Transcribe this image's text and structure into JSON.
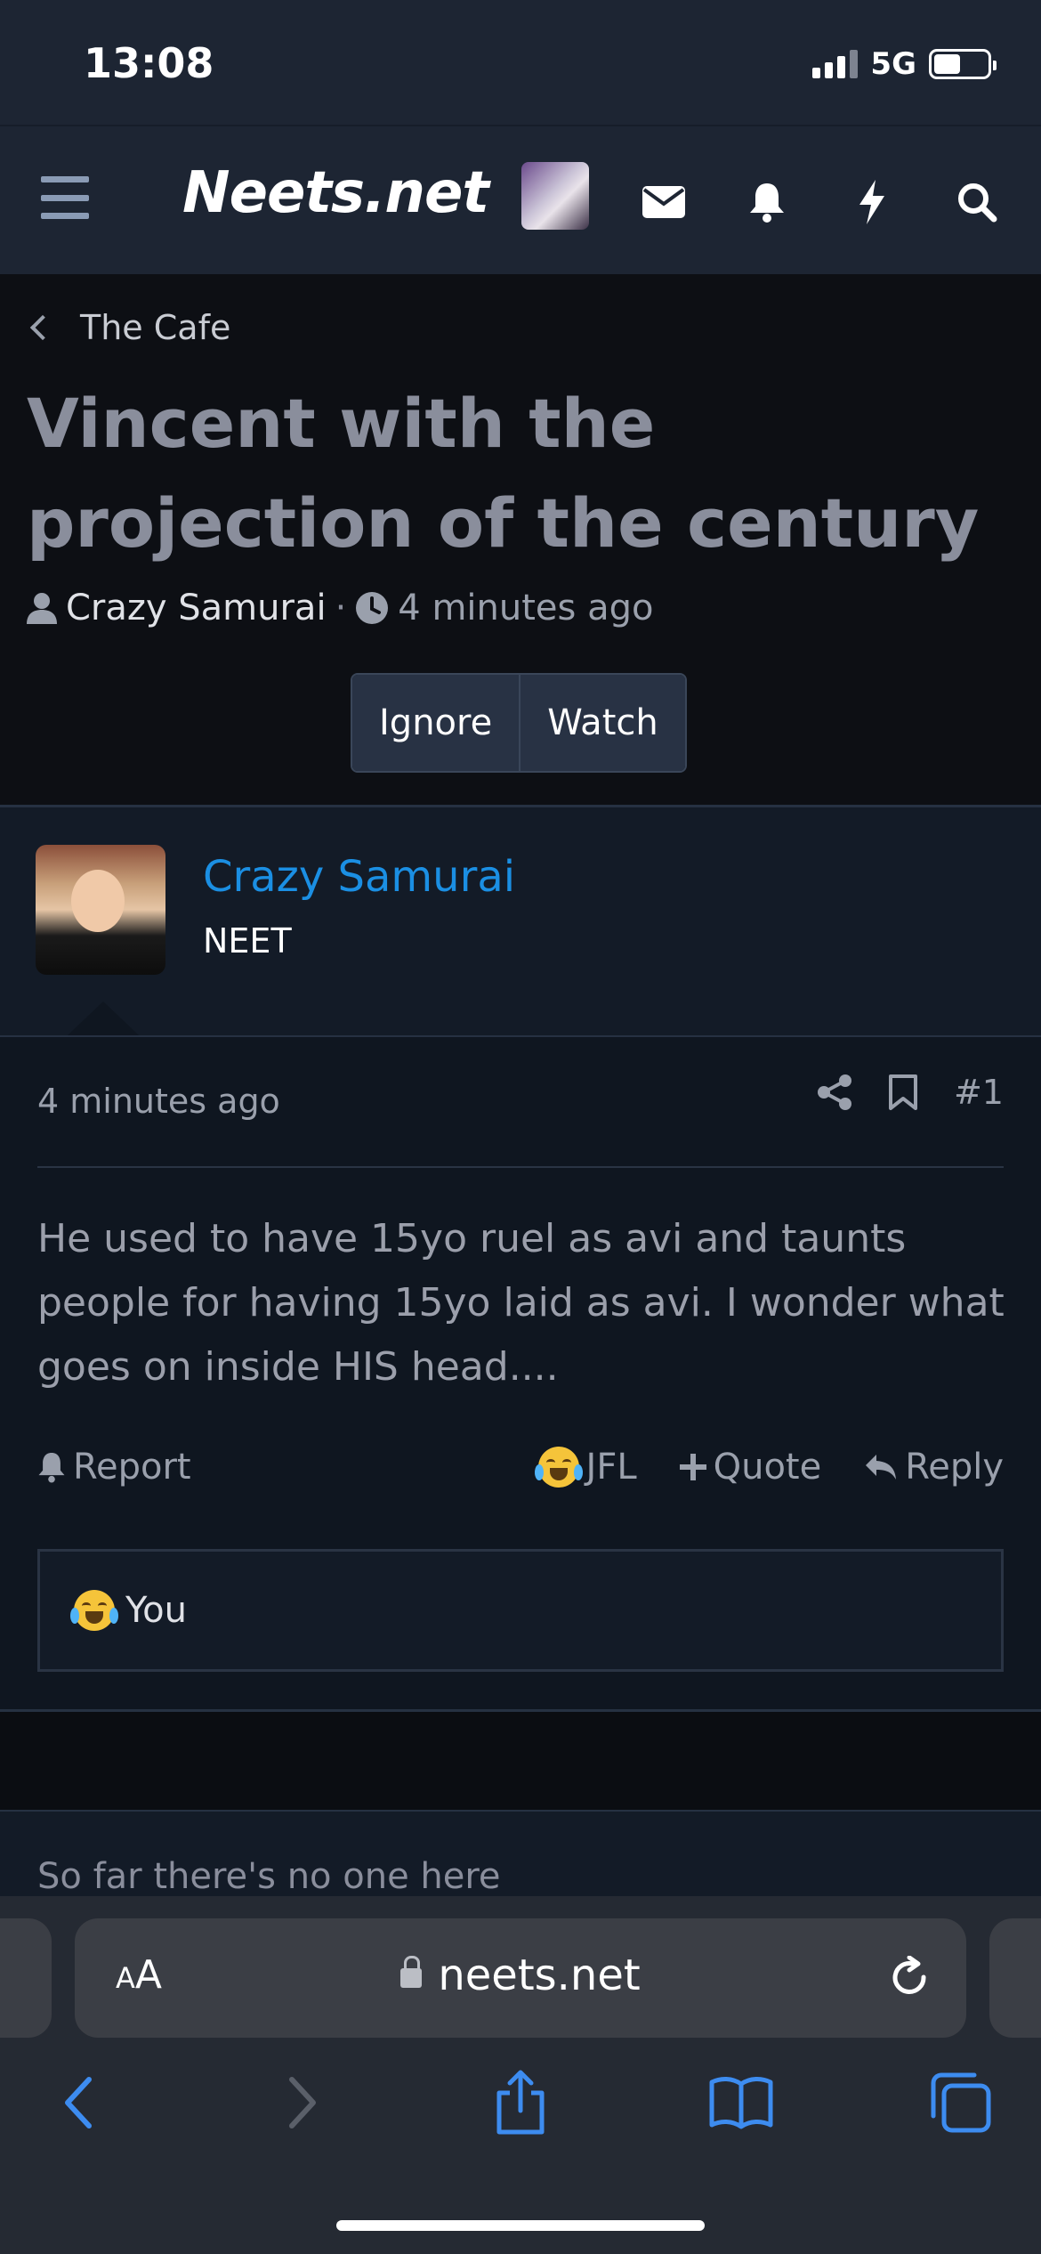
{
  "status": {
    "time": "13:08",
    "network": "5G"
  },
  "header": {
    "logo": "Neets.net"
  },
  "breadcrumb": {
    "label": "The Cafe"
  },
  "thread": {
    "title": "Vincent with the projection of the century",
    "author": "Crazy Samurai",
    "time": "4 minutes ago",
    "ignore_label": "Ignore",
    "watch_label": "Watch"
  },
  "post": {
    "author": "Crazy Samurai",
    "role": "NEET",
    "time": "4 minutes ago",
    "number": "#1",
    "body": "He used to have 15yo ruel as avi and taunts people for having 15yo laid as avi. I wonder what goes on inside HIS head....",
    "actions": {
      "report": "Report",
      "reaction": "JFL",
      "quote": "Quote",
      "reply": "Reply"
    },
    "reacted_by": "You"
  },
  "footer": {
    "empty_message": "So far there's no one here"
  },
  "browser": {
    "url": "neets.net",
    "text_size_small": "A",
    "text_size_large": "A"
  },
  "colors": {
    "accent": "#1b8fe3",
    "nav_bg": "#1d2533",
    "ios_blue": "#3d8cf0"
  }
}
